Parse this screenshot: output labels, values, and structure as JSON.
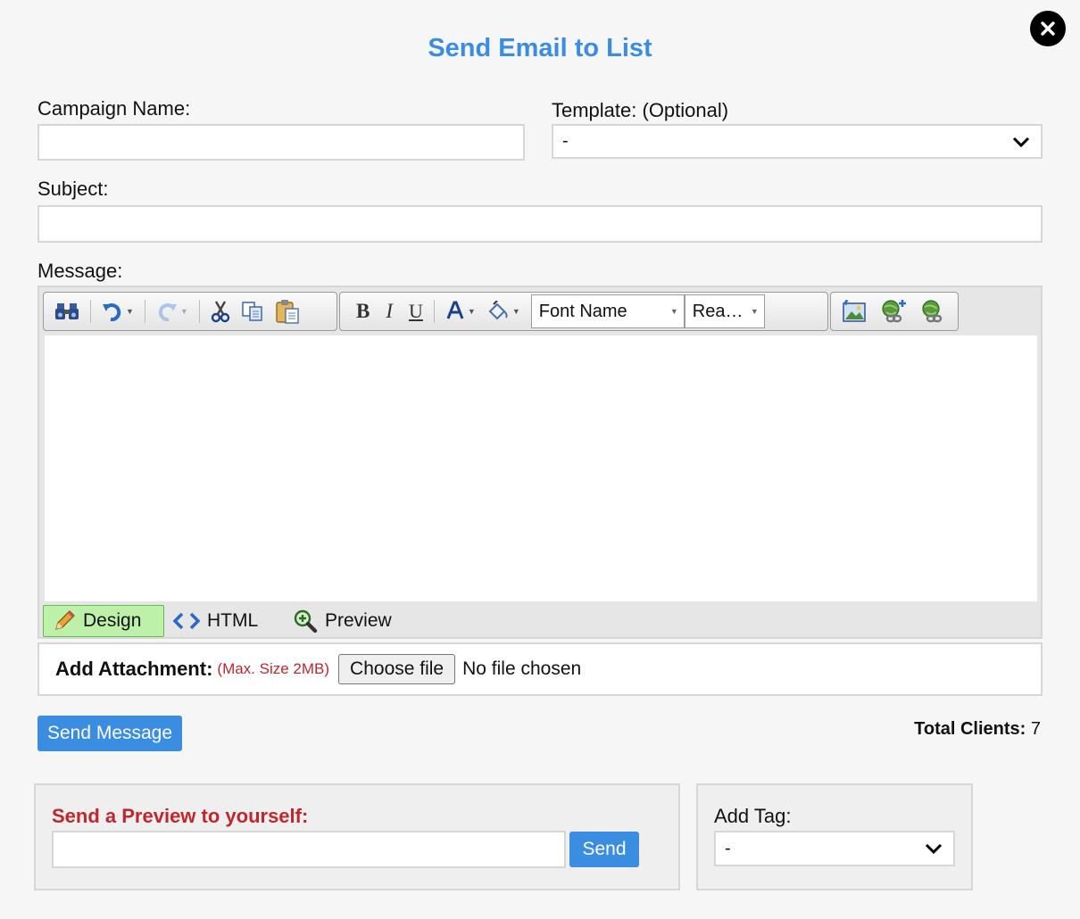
{
  "dialog": {
    "title": "Send Email to List"
  },
  "form": {
    "campaign_name": {
      "label": "Campaign Name:",
      "value": ""
    },
    "template": {
      "label": "Template: (Optional)",
      "selected": "-"
    },
    "subject": {
      "label": "Subject:",
      "value": ""
    },
    "message": {
      "label": "Message:"
    }
  },
  "editor": {
    "toolbar": {
      "font_name": "Font Name",
      "font_size": "Rea…"
    },
    "modes": [
      {
        "label": "Design",
        "icon": "pencil-icon",
        "active": true
      },
      {
        "label": "HTML",
        "icon": "code-icon",
        "active": false
      },
      {
        "label": "Preview",
        "icon": "magnifier-icon",
        "active": false
      }
    ],
    "content": ""
  },
  "attachment": {
    "label": "Add Attachment:",
    "note": "(Max. Size 2MB)",
    "button": "Choose file",
    "status": "No file chosen"
  },
  "actions": {
    "send_message": "Send Message",
    "total_label": "Total Clients:",
    "total_value": "7"
  },
  "preview": {
    "label": "Send a Preview to yourself:",
    "value": "",
    "button": "Send"
  },
  "tag": {
    "label": "Add Tag:",
    "selected": "-"
  },
  "colors": {
    "accent": "#3a8de0",
    "warning": "#c0272d",
    "design_tab": "#bdf0a8"
  }
}
